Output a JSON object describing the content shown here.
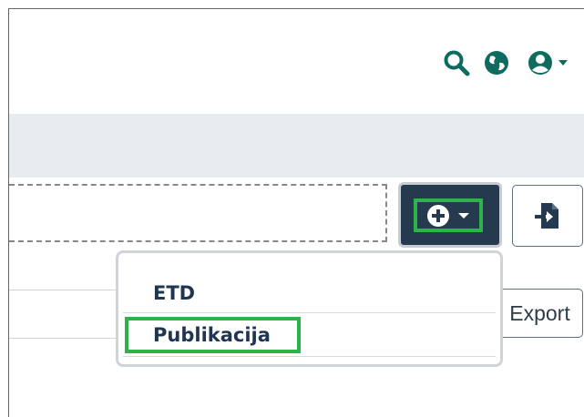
{
  "header": {
    "icons": [
      "search-icon",
      "globe-icon",
      "user-icon",
      "caret-down-icon"
    ],
    "accent_color": "#0f6b5e"
  },
  "toolbar": {
    "add_button_icons": [
      "plus-circle-icon",
      "caret-down-icon"
    ],
    "import_icon": "import-icon",
    "export_label": "Export"
  },
  "add_menu": {
    "items": [
      {
        "label": "ETD"
      },
      {
        "label": "Publikacija"
      }
    ]
  },
  "colors": {
    "button_dark": "#25394f",
    "highlight_green": "#2db34a",
    "subbar": "#e9ecef"
  }
}
